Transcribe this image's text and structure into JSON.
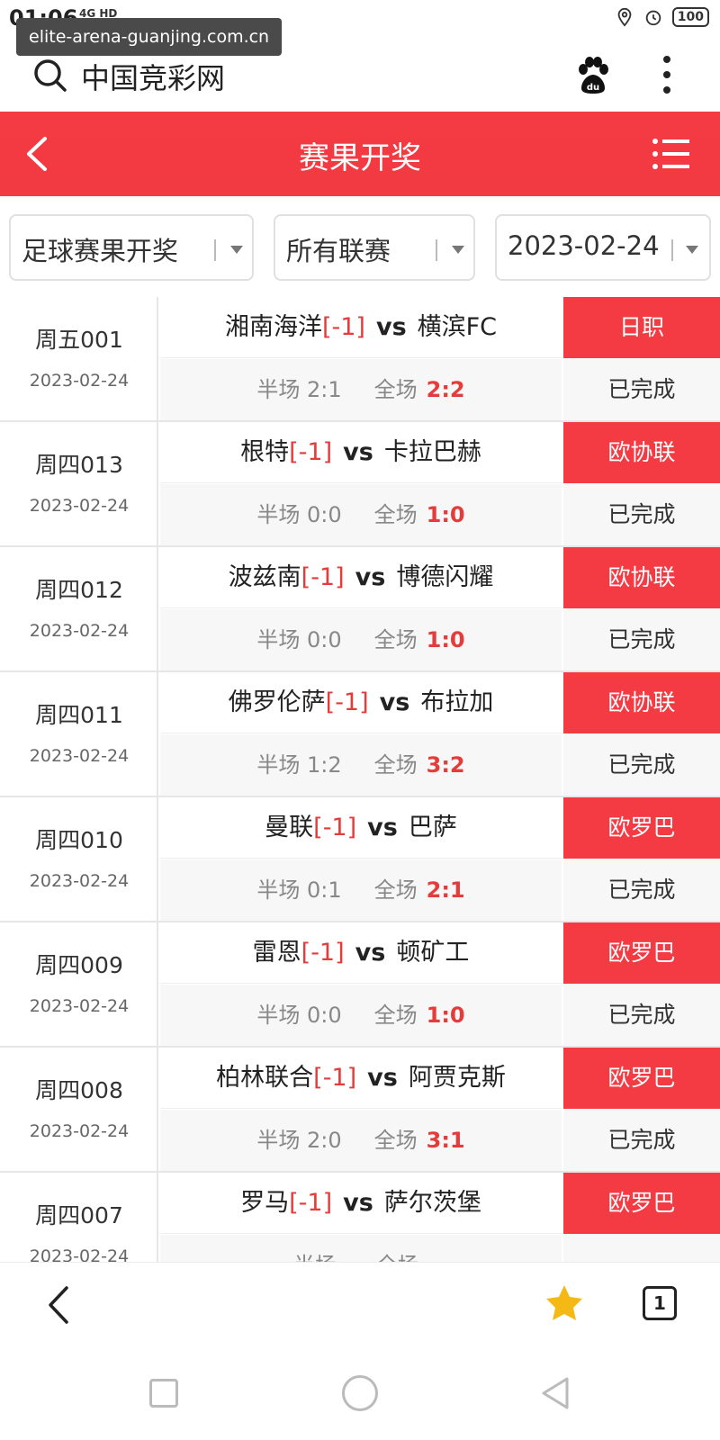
{
  "status_bar": {
    "time": "01:06",
    "network": "4G HD",
    "battery": "100"
  },
  "url_overlay": "elite-arena-guanjing.com.cn",
  "browser": {
    "site_title": "中国竞彩网"
  },
  "header": {
    "title": "赛果开奖"
  },
  "filters": {
    "type": "足球赛果开奖",
    "league": "所有联赛",
    "date": "2023-02-24"
  },
  "labels": {
    "half": "半场",
    "full": "全场",
    "vs": "vs"
  },
  "matches": [
    {
      "code": "周五001",
      "date": "2023-02-24",
      "home": "湘南海洋",
      "handicap": "[-1]",
      "away": "横滨FC",
      "half": "2:1",
      "full": "2:2",
      "league": "日职",
      "status": "已完成"
    },
    {
      "code": "周四013",
      "date": "2023-02-24",
      "home": "根特",
      "handicap": "[-1]",
      "away": "卡拉巴赫",
      "half": "0:0",
      "full": "1:0",
      "league": "欧协联",
      "status": "已完成"
    },
    {
      "code": "周四012",
      "date": "2023-02-24",
      "home": "波兹南",
      "handicap": "[-1]",
      "away": "博德闪耀",
      "half": "0:0",
      "full": "1:0",
      "league": "欧协联",
      "status": "已完成"
    },
    {
      "code": "周四011",
      "date": "2023-02-24",
      "home": "佛罗伦萨",
      "handicap": "[-1]",
      "away": "布拉加",
      "half": "1:2",
      "full": "3:2",
      "league": "欧协联",
      "status": "已完成"
    },
    {
      "code": "周四010",
      "date": "2023-02-24",
      "home": "曼联",
      "handicap": "[-1]",
      "away": "巴萨",
      "half": "0:1",
      "full": "2:1",
      "league": "欧罗巴",
      "status": "已完成"
    },
    {
      "code": "周四009",
      "date": "2023-02-24",
      "home": "雷恩",
      "handicap": "[-1]",
      "away": "顿矿工",
      "half": "0:0",
      "full": "1:0",
      "league": "欧罗巴",
      "status": "已完成"
    },
    {
      "code": "周四008",
      "date": "2023-02-24",
      "home": "柏林联合",
      "handicap": "[-1]",
      "away": "阿贾克斯",
      "half": "2:0",
      "full": "3:1",
      "league": "欧罗巴",
      "status": "已完成"
    },
    {
      "code": "周四007",
      "date": "2023-02-24",
      "home": "罗马",
      "handicap": "[-1]",
      "away": "萨尔茨堡",
      "half": "",
      "full": "",
      "league": "欧罗巴",
      "status": ""
    }
  ],
  "bottom_bar": {
    "tab_count": "1"
  },
  "colors": {
    "accent": "#f43b43",
    "score": "#e53b3b"
  },
  "icons": [
    "search-icon",
    "paw-icon",
    "more-icon",
    "back-icon",
    "menu-icon",
    "star-icon",
    "tabs-icon"
  ]
}
